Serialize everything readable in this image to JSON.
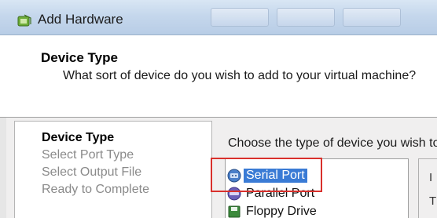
{
  "window": {
    "title": "Add Hardware",
    "icon": "add-hardware-icon"
  },
  "header": {
    "title": "Device Type",
    "subtitle": "What sort of device do you wish to add to your virtual machine?"
  },
  "steps": [
    {
      "label": "Device Type",
      "state": "active"
    },
    {
      "label": "Select Port Type",
      "state": "pending"
    },
    {
      "label": "Select Output File",
      "state": "pending"
    },
    {
      "label": "Ready to Complete",
      "state": "pending"
    }
  ],
  "content": {
    "prompt": "Choose the type of device you wish to"
  },
  "device_list": {
    "items": [
      {
        "label": "Serial Port",
        "icon": "serial-port-icon",
        "selected": true
      },
      {
        "label": "Parallel Port",
        "icon": "parallel-port-icon",
        "selected": false
      },
      {
        "label": "Floppy Drive",
        "icon": "floppy-drive-icon",
        "selected": false
      }
    ]
  },
  "info_panel": {
    "group_letter": "I",
    "text_letter": "T"
  },
  "colors": {
    "selection": "#3a7bd5",
    "highlight_annotation": "#d9302c"
  }
}
